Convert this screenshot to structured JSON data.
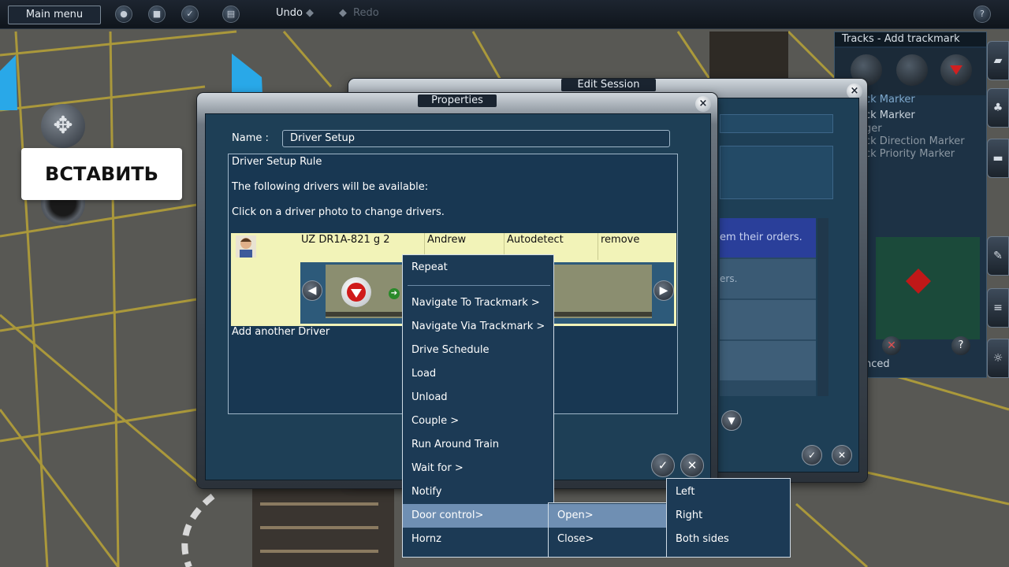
{
  "topbar": {
    "main_menu": "Main menu",
    "undo": "Undo",
    "redo": "Redo",
    "help": "?"
  },
  "overlay_button": "ВСТАВИТЬ",
  "tracks_panel": {
    "title": "Tracks - Add trackmark",
    "items": [
      "ck Marker",
      "ck Marker",
      "ger",
      "ck Direction Marker",
      "ck Priority Marker"
    ],
    "footer": "nced"
  },
  "edit_session": {
    "title": "Edit Session",
    "list_rows": [
      "em their orders.",
      "ers."
    ]
  },
  "properties": {
    "title": "Properties",
    "name_label": "Name :",
    "name_value": "Driver Setup",
    "rule_title": "Driver Setup Rule",
    "line1": "The following drivers will be available:",
    "line2": "Click on a driver photo to change drivers.",
    "driver_row": {
      "loco": "UZ DR1A-821 g 2",
      "driver": "Andrew",
      "mode": "Autodetect",
      "action": "remove"
    },
    "add_driver": "Add another Driver"
  },
  "context_menu": {
    "items": [
      "Repeat",
      "Navigate To Trackmark >",
      "Navigate Via Trackmark >",
      "Drive Schedule",
      "Load",
      "Unload",
      "Couple >",
      "Run Around Train",
      "Wait for >",
      "Notify",
      "Door control>",
      "Hornz"
    ],
    "selected": "Door control>"
  },
  "submenu_door": {
    "items": [
      "Open>",
      "Close>"
    ],
    "selected": "Open>"
  },
  "submenu_open": {
    "items": [
      "Left",
      "Right",
      "Both sides"
    ]
  },
  "colors": {
    "menu_bg": "#1c3a55",
    "menu_highlight": "#6f8fb3",
    "table_row": "#f2f3b8",
    "dialog_panel": "#183752"
  }
}
